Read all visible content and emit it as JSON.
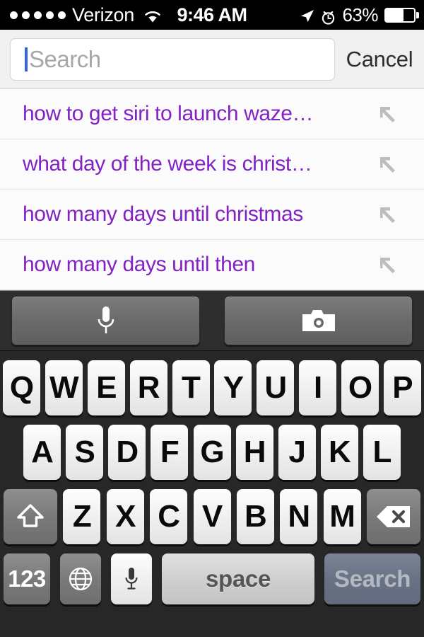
{
  "status_bar": {
    "signal_dots": 5,
    "signal_dots_total": 5,
    "carrier": "Verizon",
    "wifi_icon": "wifi-icon",
    "time": "9:46 AM",
    "location_icon": "location-arrow-icon",
    "alarm_icon": "alarm-clock-icon",
    "battery_percent_label": "63%",
    "battery_level": 63,
    "battery_icon": "battery-icon"
  },
  "search": {
    "placeholder": "Search",
    "value": "",
    "cancel_label": "Cancel",
    "caret_color": "#3366dd"
  },
  "suggestions": {
    "arrow_icon": "arrow-up-left-icon",
    "text_color": "#8322c4",
    "items": [
      {
        "text": "how to get siri to launch waze…"
      },
      {
        "text": "what day of the week is christ…"
      },
      {
        "text": "how many days until christmas"
      },
      {
        "text": "how many days until then"
      }
    ]
  },
  "toolbar": {
    "voice_search_icon": "microphone-icon",
    "camera_search_icon": "camera-icon"
  },
  "keyboard": {
    "row1": [
      "Q",
      "W",
      "E",
      "R",
      "T",
      "Y",
      "U",
      "I",
      "O",
      "P"
    ],
    "row2": [
      "A",
      "S",
      "D",
      "F",
      "G",
      "H",
      "J",
      "K",
      "L"
    ],
    "row3_letters": [
      "Z",
      "X",
      "C",
      "V",
      "B",
      "N",
      "M"
    ],
    "shift_icon": "shift-arrow-icon",
    "delete_icon": "backspace-delete-icon",
    "numbers_label": "123",
    "globe_icon": "globe-language-icon",
    "dictation_icon": "microphone-dictation-icon",
    "space_label": "space",
    "search_label": "Search"
  }
}
